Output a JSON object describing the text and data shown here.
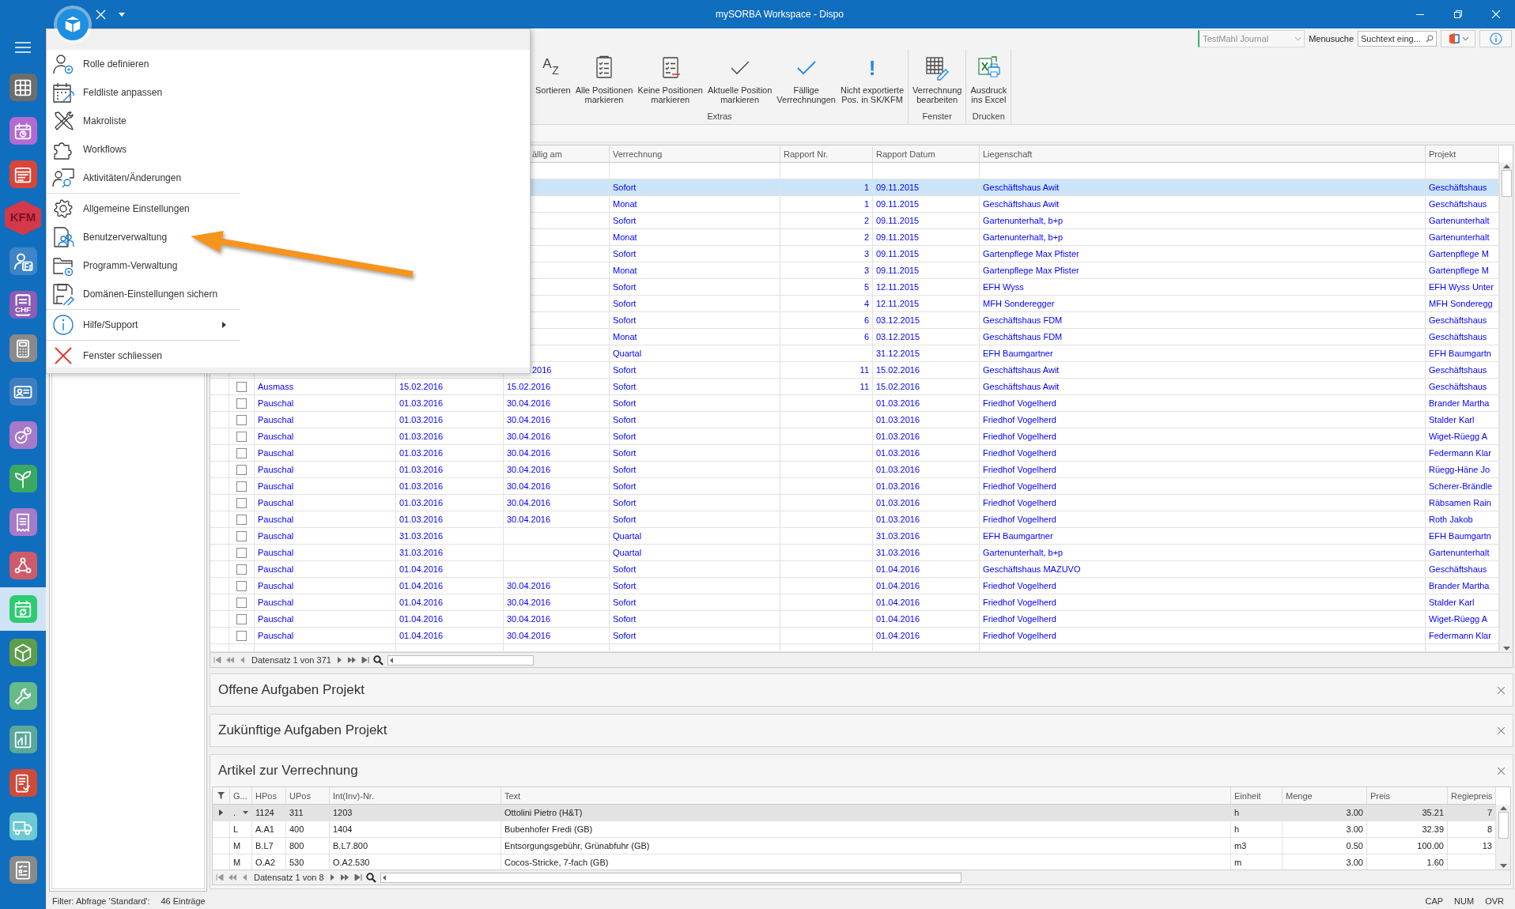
{
  "window": {
    "title": "mySORBA Workspace - Dispo"
  },
  "rail": {
    "items": [
      {
        "kind": "grid",
        "color": "#6d6d6d",
        "selected": false
      },
      {
        "kind": "calendar-clock",
        "color": "#b36ad1",
        "selected": false
      },
      {
        "kind": "calendar-notes",
        "color": "#d9453a",
        "selected": false
      },
      {
        "kind": "logo",
        "label": "KFM",
        "color": "#d3394a",
        "selected": false
      },
      {
        "kind": "person-tag",
        "label": "Fr",
        "color": "#3d85c6",
        "selected": false
      },
      {
        "kind": "doc-money",
        "label": "CHF",
        "color": "#8e5bb5",
        "selected": false
      },
      {
        "kind": "calculator",
        "color": "#8a8a8a",
        "selected": false
      },
      {
        "kind": "id-card",
        "color": "#3f7fc0",
        "selected": false
      },
      {
        "kind": "check-clock",
        "color": "#a779c9",
        "selected": false
      },
      {
        "kind": "sprout",
        "color": "#3aa860",
        "selected": false
      },
      {
        "kind": "receipt",
        "color": "#a77bc9",
        "selected": false
      },
      {
        "kind": "nodes",
        "color": "#cf5a6b",
        "selected": false
      },
      {
        "kind": "calendar-sync",
        "color": "#2ecc71",
        "selected": true
      },
      {
        "kind": "box",
        "color": "#5d9e4a",
        "selected": false
      },
      {
        "kind": "wrench",
        "color": "#66bb88",
        "selected": false
      },
      {
        "kind": "chart",
        "color": "#5aa898",
        "selected": false
      },
      {
        "kind": "doc-check",
        "color": "#d04a3a",
        "selected": false
      },
      {
        "kind": "truck",
        "color": "#6cc9d3",
        "selected": false
      },
      {
        "kind": "checklist",
        "color": "#8a8a8a",
        "selected": false
      }
    ]
  },
  "toolbar": {
    "journal": {
      "value": "TestMahl Journal",
      "disabled": true
    },
    "search_label": "Menusuche",
    "search": {
      "placeholder": "Suchtext eing..."
    }
  },
  "ribbon": {
    "groups": [
      {
        "label": "Extras",
        "buttons": [
          {
            "kind": "sort",
            "glyph": "AZ",
            "lines": [
              "Sortieren"
            ]
          },
          {
            "kind": "mark-all",
            "lines": [
              "Alle Positionen",
              "markieren"
            ]
          },
          {
            "kind": "mark-none",
            "lines": [
              "Keine Positionen",
              "markieren"
            ]
          },
          {
            "kind": "mark-current",
            "lines": [
              "Aktuelle Position",
              "markieren"
            ]
          },
          {
            "kind": "due",
            "lines": [
              "Fällige",
              "Verrechnungen"
            ]
          },
          {
            "kind": "alert",
            "glyph": "!",
            "lines": [
              "Nicht exportierte",
              "Pos. in SK/KFM"
            ]
          }
        ]
      },
      {
        "label": "Fenster",
        "buttons": [
          {
            "kind": "edit-table",
            "lines": [
              "Verrechnung",
              "bearbeiten"
            ]
          }
        ]
      },
      {
        "label": "Drucken",
        "buttons": [
          {
            "kind": "excel",
            "lines": [
              "Ausdruck",
              "ins Excel"
            ]
          }
        ]
      }
    ]
  },
  "menu": {
    "items": [
      {
        "kind": "role",
        "label": "Rolle definieren"
      },
      {
        "kind": "fieldlist",
        "label": "Feldliste anpassen"
      },
      {
        "kind": "macro",
        "label": "Makroliste"
      },
      {
        "kind": "workflow",
        "label": "Workflows"
      },
      {
        "kind": "activity",
        "label": "Aktivitäten/Änderungen"
      },
      {
        "kind": "settings",
        "label": "Allgemeine Einstellungen",
        "separator_before": true
      },
      {
        "kind": "users",
        "label": "Benutzerverwaltung"
      },
      {
        "kind": "program",
        "label": "Programm-Verwaltung"
      },
      {
        "kind": "save",
        "label": "Domänen-Einstellungen sichern"
      },
      {
        "kind": "info",
        "label": "Hilfe/Support",
        "separator_before": true,
        "submenu": true
      },
      {
        "kind": "close",
        "label": "Fenster schliessen",
        "separator_before": true
      }
    ]
  },
  "grid": {
    "columns": [
      "ällig am",
      "Verrechnung",
      "Rapport Nr.",
      "Rapport Datum",
      "Liegenschaft",
      "Projekt"
    ],
    "rows": [
      {
        "selected": true,
        "verrechnung": "Sofort",
        "rapport_nr": "1",
        "rapport_datum": "09.11.2015",
        "liegenschaft": "Geschäftshaus Awit",
        "projekt": "Geschäftshaus"
      },
      {
        "selected": false,
        "verrechnung": "Monat",
        "rapport_nr": "1",
        "rapport_datum": "09.11.2015",
        "liegenschaft": "Geschäftshaus Awit",
        "projekt": "Geschäftshaus"
      },
      {
        "selected": false,
        "verrechnung": "Sofort",
        "rapport_nr": "2",
        "rapport_datum": "09.11.2015",
        "liegenschaft": "Gartenunterhalt, b+p",
        "projekt": "Gartenunterhalt"
      },
      {
        "selected": false,
        "verrechnung": "Monat",
        "rapport_nr": "2",
        "rapport_datum": "09.11.2015",
        "liegenschaft": "Gartenunterhalt, b+p",
        "projekt": "Gartenunterhalt"
      },
      {
        "selected": false,
        "verrechnung": "Sofort",
        "rapport_nr": "3",
        "rapport_datum": "09.11.2015",
        "liegenschaft": "Gartenpflege Max Pfister",
        "projekt": "Gartenpflege M"
      },
      {
        "selected": false,
        "verrechnung": "Monat",
        "rapport_nr": "3",
        "rapport_datum": "09.11.2015",
        "liegenschaft": "Gartenpflege Max Pfister",
        "projekt": "Gartenpflege M"
      },
      {
        "selected": false,
        "verrechnung": "Sofort",
        "rapport_nr": "5",
        "rapport_datum": "12.11.2015",
        "liegenschaft": "EFH Wyss",
        "projekt": "EFH Wyss Unter"
      },
      {
        "selected": false,
        "verrechnung": "Sofort",
        "rapport_nr": "4",
        "rapport_datum": "12.11.2015",
        "liegenschaft": "MFH Sonderegger",
        "projekt": "MFH Sonderegg"
      },
      {
        "selected": false,
        "verrechnung": "Sofort",
        "rapport_nr": "6",
        "rapport_datum": "03.12.2015",
        "liegenschaft": "Geschäftshaus FDM",
        "projekt": "Geschäftshaus"
      },
      {
        "selected": false,
        "verrechnung": "Monat",
        "rapport_nr": "6",
        "rapport_datum": "03.12.2015",
        "liegenschaft": "Geschäftshaus FDM",
        "projekt": "Geschäftshaus"
      },
      {
        "selected": false,
        "verrechnung": "Quartal",
        "rapport_datum": "31.12.2015",
        "liegenschaft": "EFH Baumgartner",
        "projekt": "EFH Baumgartn"
      },
      {
        "selected": false,
        "faellig_am": "2016",
        "verrechnung": "Sofort",
        "rapport_nr": "11",
        "rapport_datum": "15.02.2016",
        "liegenschaft": "Geschäftshaus Awit",
        "projekt": "Geschäftshaus"
      },
      {
        "selected": false,
        "checked": false,
        "art": "Ausmass",
        "datum": "15.02.2016",
        "faellig_am": "15.02.2016",
        "verrechnung": "Sofort",
        "rapport_nr": "11",
        "rapport_datum": "15.02.2016",
        "liegenschaft": "Geschäftshaus Awit",
        "projekt": "Geschäftshaus"
      },
      {
        "selected": false,
        "checked": false,
        "art": "Pauschal",
        "datum": "01.03.2016",
        "faellig_am": "30.04.2016",
        "verrechnung": "Sofort",
        "rapport_datum": "01.03.2016",
        "liegenschaft": "Friedhof Vogelherd",
        "projekt": "Brander Martha"
      },
      {
        "selected": false,
        "checked": false,
        "art": "Pauschal",
        "datum": "01.03.2016",
        "faellig_am": "30.04.2016",
        "verrechnung": "Sofort",
        "rapport_datum": "01.03.2016",
        "liegenschaft": "Friedhof Vogelherd",
        "projekt": "Stalder Karl"
      },
      {
        "selected": false,
        "checked": false,
        "art": "Pauschal",
        "datum": "01.03.2016",
        "faellig_am": "30.04.2016",
        "verrechnung": "Sofort",
        "rapport_datum": "01.03.2016",
        "liegenschaft": "Friedhof Vogelherd",
        "projekt": "Wiget-Rüegg A"
      },
      {
        "selected": false,
        "checked": false,
        "art": "Pauschal",
        "datum": "01.03.2016",
        "faellig_am": "30.04.2016",
        "verrechnung": "Sofort",
        "rapport_datum": "01.03.2016",
        "liegenschaft": "Friedhof Vogelherd",
        "projekt": "Federmann Klar"
      },
      {
        "selected": false,
        "checked": false,
        "art": "Pauschal",
        "datum": "01.03.2016",
        "faellig_am": "30.04.2016",
        "verrechnung": "Sofort",
        "rapport_datum": "01.03.2016",
        "liegenschaft": "Friedhof Vogelherd",
        "projekt": "Rüegg-Häne Jo"
      },
      {
        "selected": false,
        "checked": false,
        "art": "Pauschal",
        "datum": "01.03.2016",
        "faellig_am": "30.04.2016",
        "verrechnung": "Sofort",
        "rapport_datum": "01.03.2016",
        "liegenschaft": "Friedhof Vogelherd",
        "projekt": "Scherer-Brändle"
      },
      {
        "selected": false,
        "checked": false,
        "art": "Pauschal",
        "datum": "01.03.2016",
        "faellig_am": "30.04.2016",
        "verrechnung": "Sofort",
        "rapport_datum": "01.03.2016",
        "liegenschaft": "Friedhof Vogelherd",
        "projekt": "Räbsamen Rain"
      },
      {
        "selected": false,
        "checked": false,
        "art": "Pauschal",
        "datum": "01.03.2016",
        "faellig_am": "30.04.2016",
        "verrechnung": "Sofort",
        "rapport_datum": "01.03.2016",
        "liegenschaft": "Friedhof Vogelherd",
        "projekt": "Roth Jakob"
      },
      {
        "selected": false,
        "checked": false,
        "art": "Pauschal",
        "datum": "31.03.2016",
        "verrechnung": "Quartal",
        "rapport_datum": "31.03.2016",
        "liegenschaft": "EFH Baumgartner",
        "projekt": "EFH Baumgartn"
      },
      {
        "selected": false,
        "checked": false,
        "art": "Pauschal",
        "datum": "31.03.2016",
        "verrechnung": "Quartal",
        "rapport_datum": "31.03.2016",
        "liegenschaft": "Gartenunterhalt, b+p",
        "projekt": "Gartenunterhalt"
      },
      {
        "selected": false,
        "checked": false,
        "art": "Pauschal",
        "datum": "01.04.2016",
        "verrechnung": "Sofort",
        "rapport_datum": "01.04.2016",
        "liegenschaft": "Geschäftshaus MAZUVO",
        "projekt": "Geschäftshaus"
      },
      {
        "selected": false,
        "checked": false,
        "art": "Pauschal",
        "datum": "01.04.2016",
        "faellig_am": "30.04.2016",
        "verrechnung": "Sofort",
        "rapport_datum": "01.04.2016",
        "liegenschaft": "Friedhof Vogelherd",
        "projekt": "Brander Martha"
      },
      {
        "selected": false,
        "checked": false,
        "art": "Pauschal",
        "datum": "01.04.2016",
        "faellig_am": "30.04.2016",
        "verrechnung": "Sofort",
        "rapport_datum": "01.04.2016",
        "liegenschaft": "Friedhof Vogelherd",
        "projekt": "Stalder Karl"
      },
      {
        "selected": false,
        "checked": false,
        "art": "Pauschal",
        "datum": "01.04.2016",
        "faellig_am": "30.04.2016",
        "verrechnung": "Sofort",
        "rapport_datum": "01.04.2016",
        "liegenschaft": "Friedhof Vogelherd",
        "projekt": "Wiget-Rüegg A"
      },
      {
        "selected": false,
        "checked": false,
        "art": "Pauschal",
        "datum": "01.04.2016",
        "faellig_am": "30.04.2016",
        "verrechnung": "Sofort",
        "rapport_datum": "01.04.2016",
        "liegenschaft": "Friedhof Vogelherd",
        "projekt": "Federmann Klar"
      }
    ],
    "footer": "Datensatz 1 von 371"
  },
  "panels": [
    {
      "title": "Offene Aufgaben Projekt"
    },
    {
      "title": "Zukünftige Aufgaben Projekt"
    },
    {
      "title": "Artikel zur Verrechnung",
      "table": {
        "columns": [
          "G...",
          "HPos",
          "UPos",
          "Int(Inv)-Nr.",
          "Text",
          "Einheit",
          "Menge",
          "Preis",
          "Regiepreis"
        ],
        "rows": [
          {
            "selected": true,
            "cells": [
              ".",
              "1124",
              "311",
              "1203",
              "Ottolini Pietro (H&T)",
              "h",
              "3.00",
              "35.21",
              "7"
            ]
          },
          {
            "selected": false,
            "cells": [
              "L",
              "A.A1",
              "400",
              "1404",
              "Bubenhofer Fredi (GB)",
              "h",
              "3.00",
              "32.39",
              "8"
            ]
          },
          {
            "selected": false,
            "cells": [
              "M",
              "B.L7",
              "800",
              "B.L7.800",
              "Entsorgungsgebühr, Grünabfuhr (GB)",
              "m3",
              "0.50",
              "100.00",
              "13"
            ]
          },
          {
            "selected": false,
            "cells": [
              "M",
              "O.A2",
              "530",
              "O.A2.530",
              "Cocos-Stricke, 7-fach (GB)",
              "m",
              "3.00",
              "1.60",
              ""
            ]
          }
        ],
        "footer": "Datensatz 1 von 8"
      }
    }
  ],
  "status_bar": {
    "filter": "Filter: Abfrage 'Standard':",
    "count": "46 Einträge",
    "indicators": [
      "CAP",
      "NUM",
      "OVR"
    ]
  }
}
